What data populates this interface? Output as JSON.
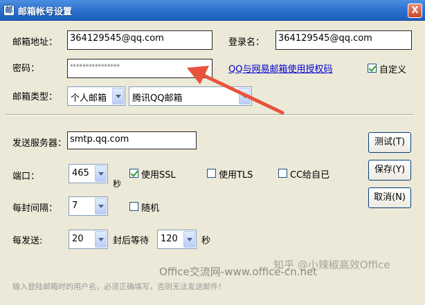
{
  "window": {
    "title": "邮箱帐号设置",
    "icon": "app-icon",
    "close_label": "X"
  },
  "account": {
    "email_label": "邮箱地址：",
    "email_value": "364129545@qq.com",
    "login_label": "登录名：",
    "login_value": "364129545@qq.com",
    "password_label": "密码：",
    "password_value": "****************",
    "auth_link": "QQ与网易邮箱使用授权码",
    "custom_label": "自定义",
    "custom_checked": true,
    "type_label": "邮箱类型：",
    "type_value": "个人邮箱",
    "provider_value": "腾讯QQ邮箱"
  },
  "server": {
    "smtp_label": "发送服务器：",
    "smtp_value": "smtp.qq.com",
    "port_label": "端口：",
    "port_value": "465",
    "port_unit": "秒",
    "ssl_label": "使用SSL",
    "ssl_checked": true,
    "tls_label": "使用TLS",
    "tls_checked": false,
    "cc_label": "CC给自已",
    "cc_checked": false,
    "interval_label": "每封间隔：",
    "interval_value": "7",
    "random_label": "随机",
    "random_checked": false,
    "batch_label": "每发送:",
    "batch_value": "20",
    "wait_label": "封后等待",
    "wait_value": "120",
    "wait_unit": "秒"
  },
  "buttons": {
    "test": "测试(T)",
    "save": "保存(Y)",
    "cancel": "取消(N)"
  },
  "hint": "输入登陆邮箱时的用户名，必须正确填写，否则无法发送邮件！",
  "watermarks": {
    "site": "Office交流网-www.office-cn.net",
    "zhihu": "知乎 @小辣椒高效Office"
  },
  "colors": {
    "title_bar": "#2a6fcc",
    "dialog_bg": "#ece9d8",
    "arrow": "#e8533c",
    "link": "#0000cc"
  }
}
